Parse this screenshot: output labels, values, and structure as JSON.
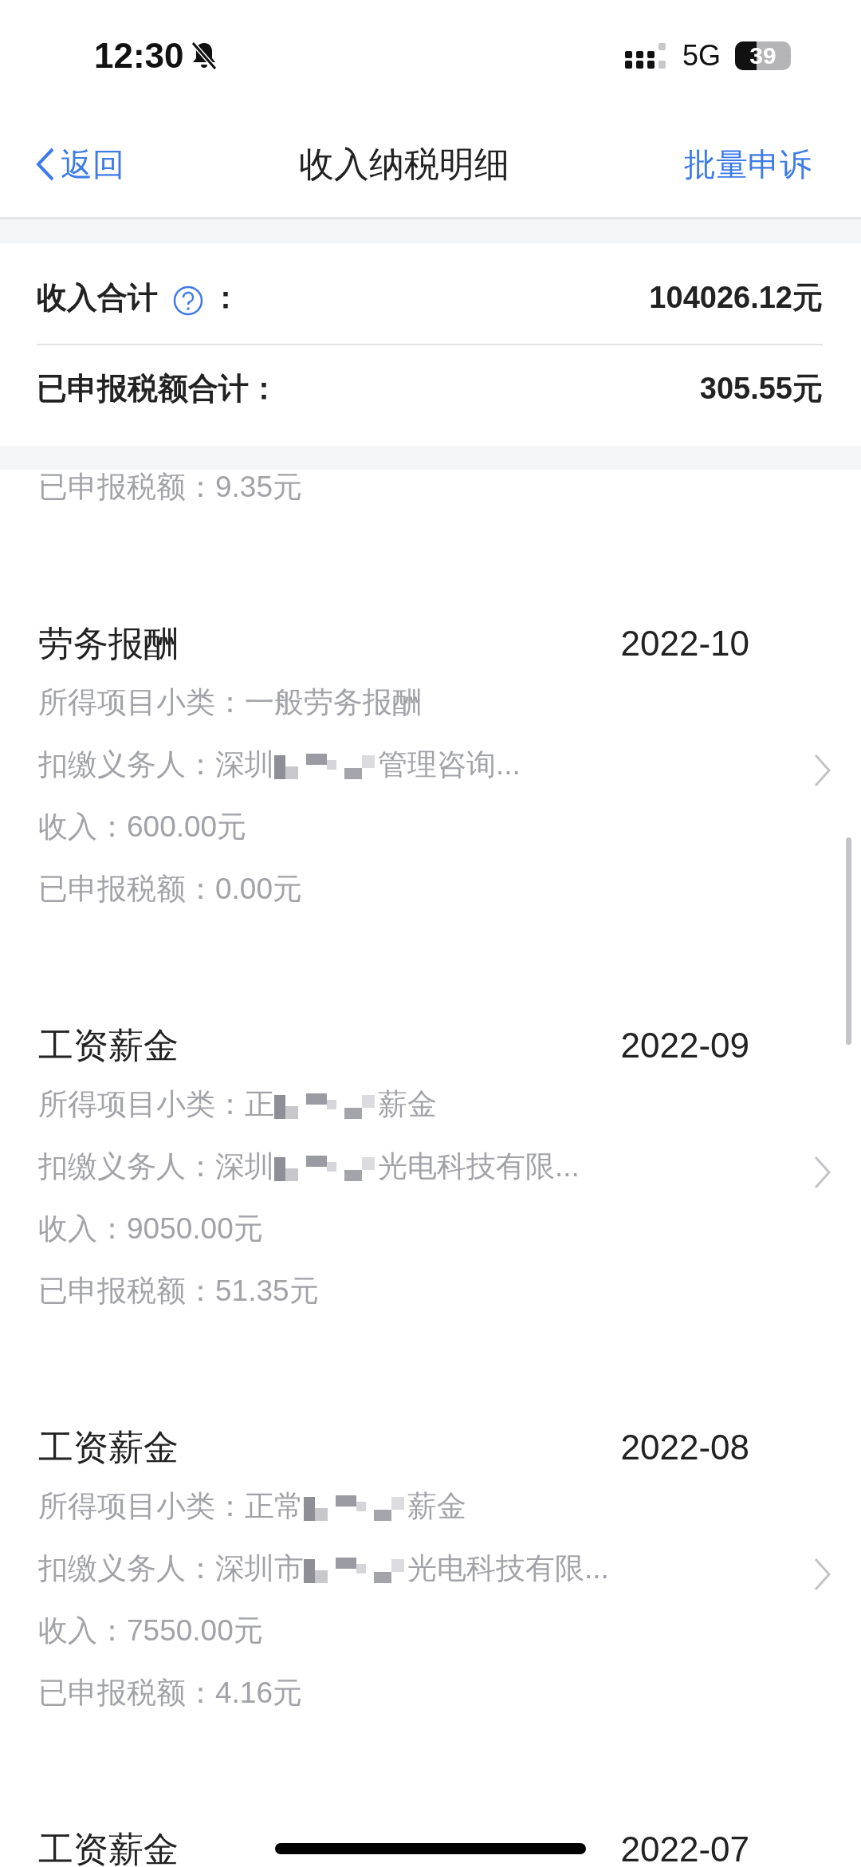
{
  "status_bar": {
    "time": "12:30",
    "network": "5G",
    "battery": "39"
  },
  "nav": {
    "back": "返回",
    "title": "收入纳税明细",
    "action": "批量申诉"
  },
  "summary": [
    {
      "label": "收入合计",
      "help": true,
      "colon": "：",
      "value": "104026.12元"
    },
    {
      "label": "已申报税额合计：",
      "value": "305.55元"
    }
  ],
  "cut_line": "已申报税额：9.35元",
  "records": [
    {
      "title": "劳务报酬",
      "period": "2022-10",
      "lines": [
        {
          "text": "所得项目小类：一般劳务报酬"
        },
        {
          "text": "扣缴义务人：深圳",
          "redacted": true,
          "rest": "管理咨询..."
        },
        {
          "text": "收入：600.00元"
        },
        {
          "text": "已申报税额：0.00元"
        }
      ]
    },
    {
      "title": "工资薪金",
      "period": "2022-09",
      "lines": [
        {
          "text": "所得项目小类：正",
          "redacted": true,
          "rest": "薪金"
        },
        {
          "text": "扣缴义务人：深圳",
          "redacted": true,
          "rest": "光电科技有限..."
        },
        {
          "text": "收入：9050.00元"
        },
        {
          "text": "已申报税额：51.35元"
        }
      ]
    },
    {
      "title": "工资薪金",
      "period": "2022-08",
      "lines": [
        {
          "text": "所得项目小类：正常",
          "redacted": true,
          "rest": "薪金"
        },
        {
          "text": "扣缴义务人：深圳市",
          "redacted": true,
          "rest": "光电科技有限..."
        },
        {
          "text": "收入：7550.00元"
        },
        {
          "text": "已申报税额：4.16元"
        }
      ]
    },
    {
      "title": "工资薪金",
      "period": "2022-07"
    }
  ]
}
